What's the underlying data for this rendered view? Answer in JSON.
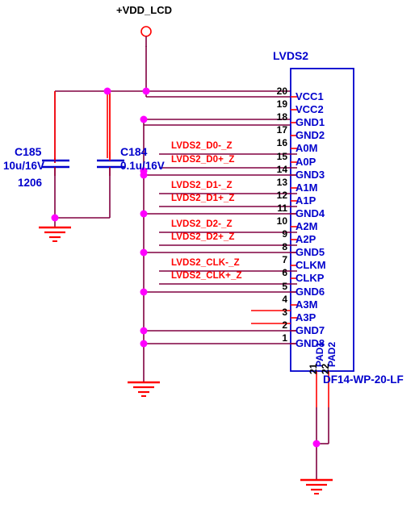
{
  "sheet": {
    "power_net": "+VDD_LCD",
    "background": "#ffffff",
    "colors": {
      "wire": "#800040",
      "pin": "#ff0000",
      "symbol_outline": "#0000cc",
      "junction": "#ff00ff",
      "net_text": "#ff0000",
      "pin_number": "#000000",
      "pin_name": "#0000cc",
      "ground": "#ff0000"
    }
  },
  "capacitors": [
    {
      "designator": "C185",
      "value": "10u/16V",
      "package": "1206"
    },
    {
      "designator": "C184",
      "value": "0.1u/16V",
      "package": ""
    }
  ],
  "connector": {
    "designator": "LVDS2",
    "footprint": "DF14-WP-20-LF",
    "pins": [
      {
        "number": "20",
        "name": "VCC1",
        "net": "",
        "connection": "vcc-bus"
      },
      {
        "number": "19",
        "name": "VCC2",
        "net": "",
        "connection": "vcc-bus"
      },
      {
        "number": "18",
        "name": "GND1",
        "net": "",
        "connection": "gnd-bus"
      },
      {
        "number": "17",
        "name": "GND2",
        "net": "",
        "connection": "gnd-bus"
      },
      {
        "number": "16",
        "name": "A0M",
        "net": "LVDS2_D0-_Z",
        "connection": "net-label"
      },
      {
        "number": "15",
        "name": "A0P",
        "net": "LVDS2_D0+_Z",
        "connection": "net-label"
      },
      {
        "number": "14",
        "name": "GND3",
        "net": "",
        "connection": "gnd-bus"
      },
      {
        "number": "13",
        "name": "A1M",
        "net": "LVDS2_D1-_Z",
        "connection": "net-label"
      },
      {
        "number": "12",
        "name": "A1P",
        "net": "LVDS2_D1+_Z",
        "connection": "net-label"
      },
      {
        "number": "11",
        "name": "GND4",
        "net": "",
        "connection": "gnd-bus"
      },
      {
        "number": "10",
        "name": "A2M",
        "net": "LVDS2_D2-_Z",
        "connection": "net-label"
      },
      {
        "number": "9",
        "name": "A2P",
        "net": "LVDS2_D2+_Z",
        "connection": "net-label"
      },
      {
        "number": "8",
        "name": "GND5",
        "net": "",
        "connection": "gnd-bus"
      },
      {
        "number": "7",
        "name": "CLKM",
        "net": "LVDS2_CLK-_Z",
        "connection": "net-label"
      },
      {
        "number": "6",
        "name": "CLKP",
        "net": "LVDS2_CLK+_Z",
        "connection": "net-label"
      },
      {
        "number": "5",
        "name": "GND6",
        "net": "",
        "connection": "gnd-bus"
      },
      {
        "number": "4",
        "name": "A3M",
        "net": "",
        "connection": "none"
      },
      {
        "number": "3",
        "name": "A3P",
        "net": "",
        "connection": "none"
      },
      {
        "number": "2",
        "name": "GND7",
        "net": "",
        "connection": "gnd-bus"
      },
      {
        "number": "1",
        "name": "GND8",
        "net": "",
        "connection": "gnd-bus"
      }
    ],
    "pads": [
      {
        "number": "21",
        "name": "PAD1"
      },
      {
        "number": "22",
        "name": "PAD2"
      }
    ]
  }
}
